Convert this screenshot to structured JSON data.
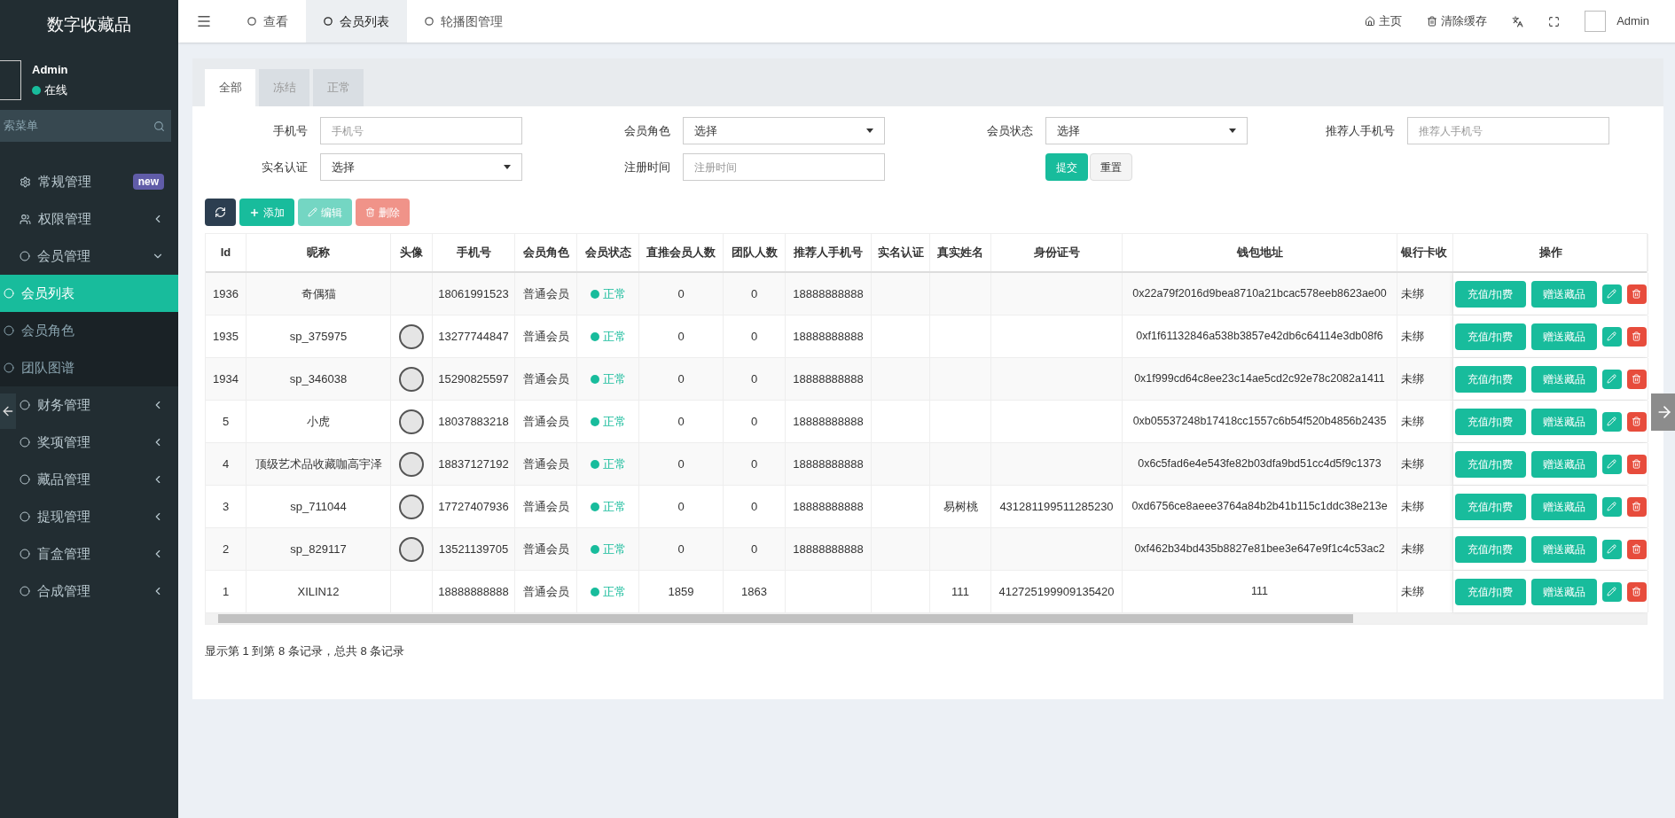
{
  "sidebar": {
    "title": "数字收藏品",
    "user": {
      "name": "Admin",
      "status": "在线"
    },
    "search": {
      "placeholder": "索菜单"
    },
    "items": [
      {
        "label": "常规管理",
        "badge": "new",
        "selected": false
      },
      {
        "label": "权限管理",
        "expanded": false,
        "selected": false
      },
      {
        "label": "会员管理",
        "expanded": true,
        "selected": false,
        "children": [
          {
            "label": "会员列表",
            "selected": true
          },
          {
            "label": "会员角色",
            "selected": false
          },
          {
            "label": "团队图谱",
            "selected": false
          }
        ]
      },
      {
        "label": "财务管理",
        "expanded": false,
        "selected": false
      },
      {
        "label": "奖项管理",
        "expanded": false,
        "selected": false
      },
      {
        "label": "藏品管理",
        "expanded": false,
        "selected": false
      },
      {
        "label": "提现管理",
        "expanded": false,
        "selected": false
      },
      {
        "label": "盲盒管理",
        "expanded": false,
        "selected": false
      },
      {
        "label": "合成管理",
        "expanded": false,
        "selected": false
      }
    ]
  },
  "topbar": {
    "tabs": [
      {
        "label": "查看",
        "selected": false
      },
      {
        "label": "会员列表",
        "selected": true
      },
      {
        "label": "轮播图管理",
        "selected": false
      }
    ],
    "actions": [
      {
        "label": "主页",
        "kind": "home"
      },
      {
        "label": "清除缓存",
        "kind": "trash"
      }
    ],
    "user": "Admin"
  },
  "status_tabs": [
    {
      "label": "全部",
      "selected": true
    },
    {
      "label": "冻结",
      "selected": false
    },
    {
      "label": "正常",
      "selected": false
    }
  ],
  "filters": [
    {
      "label": "手机号",
      "kind": "text",
      "placeholder": "手机号"
    },
    {
      "label": "会员角色",
      "kind": "select",
      "value": "选择"
    },
    {
      "label": "会员状态",
      "kind": "select",
      "value": "选择"
    },
    {
      "label": "推荐人手机号",
      "kind": "text",
      "placeholder": "推荐人手机号"
    },
    {
      "label": "实名认证",
      "kind": "select",
      "value": "选择"
    },
    {
      "label": "注册时间",
      "kind": "text",
      "placeholder": "注册时间"
    }
  ],
  "filter_buttons": [
    {
      "label": "提交",
      "kind": "primary"
    },
    {
      "label": "重置",
      "kind": "default"
    }
  ],
  "toolbar": [
    {
      "kind": "refresh",
      "disabled": false
    },
    {
      "label": "添加",
      "kind": "add",
      "disabled": false
    },
    {
      "label": "编辑",
      "kind": "edit",
      "disabled": true
    },
    {
      "label": "删除",
      "kind": "delete",
      "disabled": true
    }
  ],
  "table": {
    "columns": [
      "Id",
      "昵称",
      "头像",
      "手机号",
      "会员角色",
      "会员状态",
      "直推会员人数",
      "团队人数",
      "推荐人手机号",
      "实名认证",
      "真实姓名",
      "身份证号",
      "钱包地址",
      "银行卡收",
      "操作"
    ],
    "rows": [
      {
        "id": "1936",
        "nickname": "奇偶猫",
        "avatar": false,
        "phone": "18061991523",
        "role": "普通会员",
        "status": "正常",
        "direct": "0",
        "team": "0",
        "referrer": "18888888888",
        "wallet": "0x22a79f2016d9bea8710a21bcac578eeb8623ae00",
        "bank": "未绑",
        "actions": [
          "充值/扣费",
          "赠送藏品"
        ]
      },
      {
        "id": "1935",
        "nickname": "sp_375975",
        "avatar": true,
        "phone": "13277744847",
        "role": "普通会员",
        "status": "正常",
        "direct": "0",
        "team": "0",
        "referrer": "18888888888",
        "wallet": "0xf1f61132846a538b3857e42db6c64114e3db08f6",
        "bank": "未绑",
        "actions": [
          "充值/扣费",
          "赠送藏品"
        ]
      },
      {
        "id": "1934",
        "nickname": "sp_346038",
        "avatar": true,
        "phone": "15290825597",
        "role": "普通会员",
        "status": "正常",
        "direct": "0",
        "team": "0",
        "referrer": "18888888888",
        "wallet": "0x1f999cd64c8ee23c14ae5cd2c92e78c2082a1411",
        "bank": "未绑",
        "actions": [
          "充值/扣费",
          "赠送藏品"
        ]
      },
      {
        "id": "5",
        "nickname": "小虎",
        "avatar": true,
        "phone": "18037883218",
        "role": "普通会员",
        "status": "正常",
        "direct": "0",
        "team": "0",
        "referrer": "18888888888",
        "wallet": "0xb05537248b17418cc1557c6b54f520b4856b2435",
        "bank": "未绑",
        "actions": [
          "充值/扣费",
          "赠送藏品"
        ]
      },
      {
        "id": "4",
        "nickname": "顶级艺术品收藏咖高宇泽",
        "avatar": true,
        "phone": "18837127192",
        "role": "普通会员",
        "status": "正常",
        "direct": "0",
        "team": "0",
        "referrer": "18888888888",
        "wallet": "0x6c5fad6e4e543fe82b03dfa9bd51cc4d5f9c1373",
        "bank": "未绑",
        "actions": [
          "充值/扣费",
          "赠送藏品"
        ]
      },
      {
        "id": "3",
        "nickname": "sp_711044",
        "avatar": true,
        "phone": "17727407936",
        "role": "普通会员",
        "status": "正常",
        "direct": "0",
        "team": "0",
        "referrer": "18888888888",
        "real_name": "易树桃",
        "id_number": "431281199511285230",
        "wallet": "0xd6756ce8aeee3764a84b2b41b115c1ddc38e213e",
        "bank": "未绑",
        "actions": [
          "充值/扣费",
          "赠送藏品"
        ]
      },
      {
        "id": "2",
        "nickname": "sp_829117",
        "avatar": true,
        "phone": "13521139705",
        "role": "普通会员",
        "status": "正常",
        "direct": "0",
        "team": "0",
        "referrer": "18888888888",
        "wallet": "0xf462b34bd435b8827e81bee3e647e9f1c4c53ac2",
        "bank": "未绑",
        "actions": [
          "充值/扣费",
          "赠送藏品"
        ]
      },
      {
        "id": "1",
        "nickname": "XILIN12",
        "avatar": false,
        "phone": "18888888888",
        "role": "普通会员",
        "status": "正常",
        "direct": "1859",
        "team": "1863",
        "real_name": "111",
        "id_number": "412725199909135420",
        "wallet": "111",
        "bank": "未绑",
        "actions": [
          "充值/扣费",
          "赠送藏品"
        ]
      }
    ]
  },
  "pagination_info": "显示第 1 到第 8 条记录，总共 8 条记录"
}
